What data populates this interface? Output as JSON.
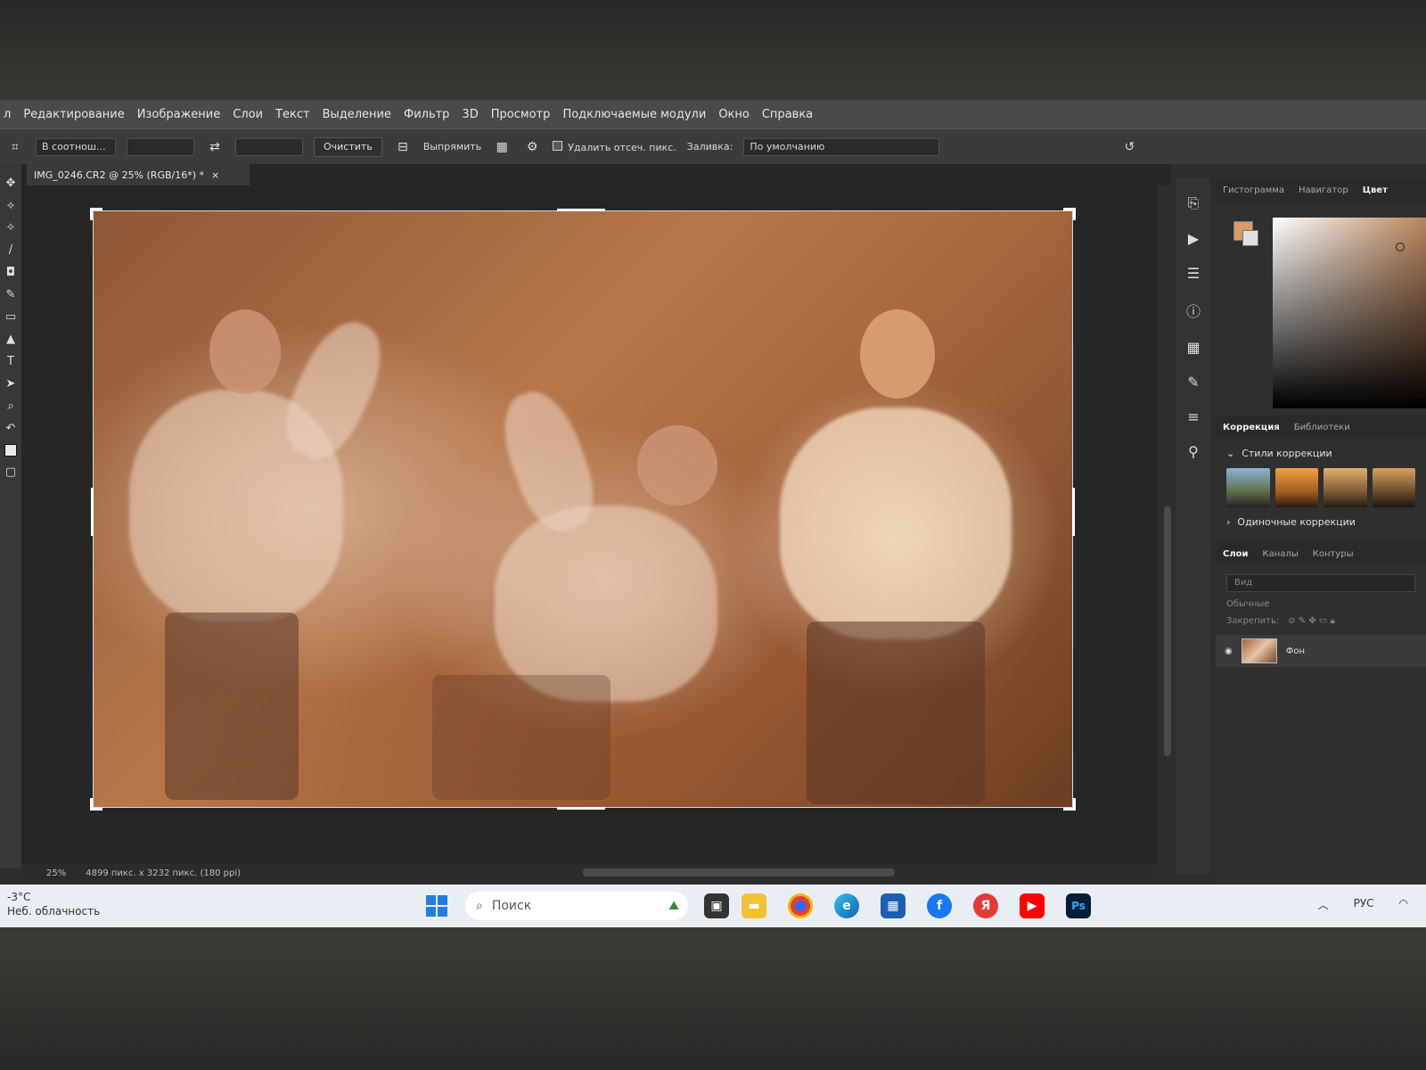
{
  "menu": [
    "л",
    "Редактирование",
    "Изображение",
    "Слои",
    "Текст",
    "Выделение",
    "Фильтр",
    "3D",
    "Просмотр",
    "Подключаемые модули",
    "Окно",
    "Справка"
  ],
  "options": {
    "ratio": "В соотнош...",
    "clear_label": "Очистить",
    "straighten_label": "Выпрямить",
    "delete_cropped_label": "Удалить отсеч. пикс.",
    "fill_label": "Заливка:",
    "fill_value": "По умолчанию"
  },
  "document": {
    "tab_title": "IMG_0246.CR2 @ 25% (RGB/16*) *",
    "close_glyph": "×"
  },
  "status": {
    "zoom": "25%",
    "dimensions": "4899 пикс. x 3232 пикс. (180 ppi)"
  },
  "panels": {
    "top_tabs": [
      "Гистограмма",
      "Навигатор",
      "Цвет"
    ],
    "adj_tabs": [
      "Коррекция",
      "Библиотеки"
    ],
    "styles_title": "Стили коррекции",
    "single_title": "Одиночные коррекции",
    "layer_tabs": [
      "Слои",
      "Каналы",
      "Контуры"
    ],
    "search_placeholder": "Вид",
    "blend_mode": "Обычные",
    "lock_label": "Закрепить:",
    "layer_name": "Фон"
  },
  "colors": {
    "foreground": "#d99b66",
    "background": "#e0e0e0"
  },
  "taskbar": {
    "temperature": "-3°C",
    "weather": "Неб. облачность",
    "search_label": "Поиск",
    "lang": "РУС",
    "apps": [
      "file-explorer-icon",
      "chrome-icon",
      "edge-icon",
      "store-icon",
      "facebook-icon",
      "yandex-icon",
      "youtube-icon",
      "photoshop-icon"
    ],
    "app_letters": {
      "facebook": "f",
      "yandex": "Я",
      "photoshop": "Ps"
    }
  }
}
